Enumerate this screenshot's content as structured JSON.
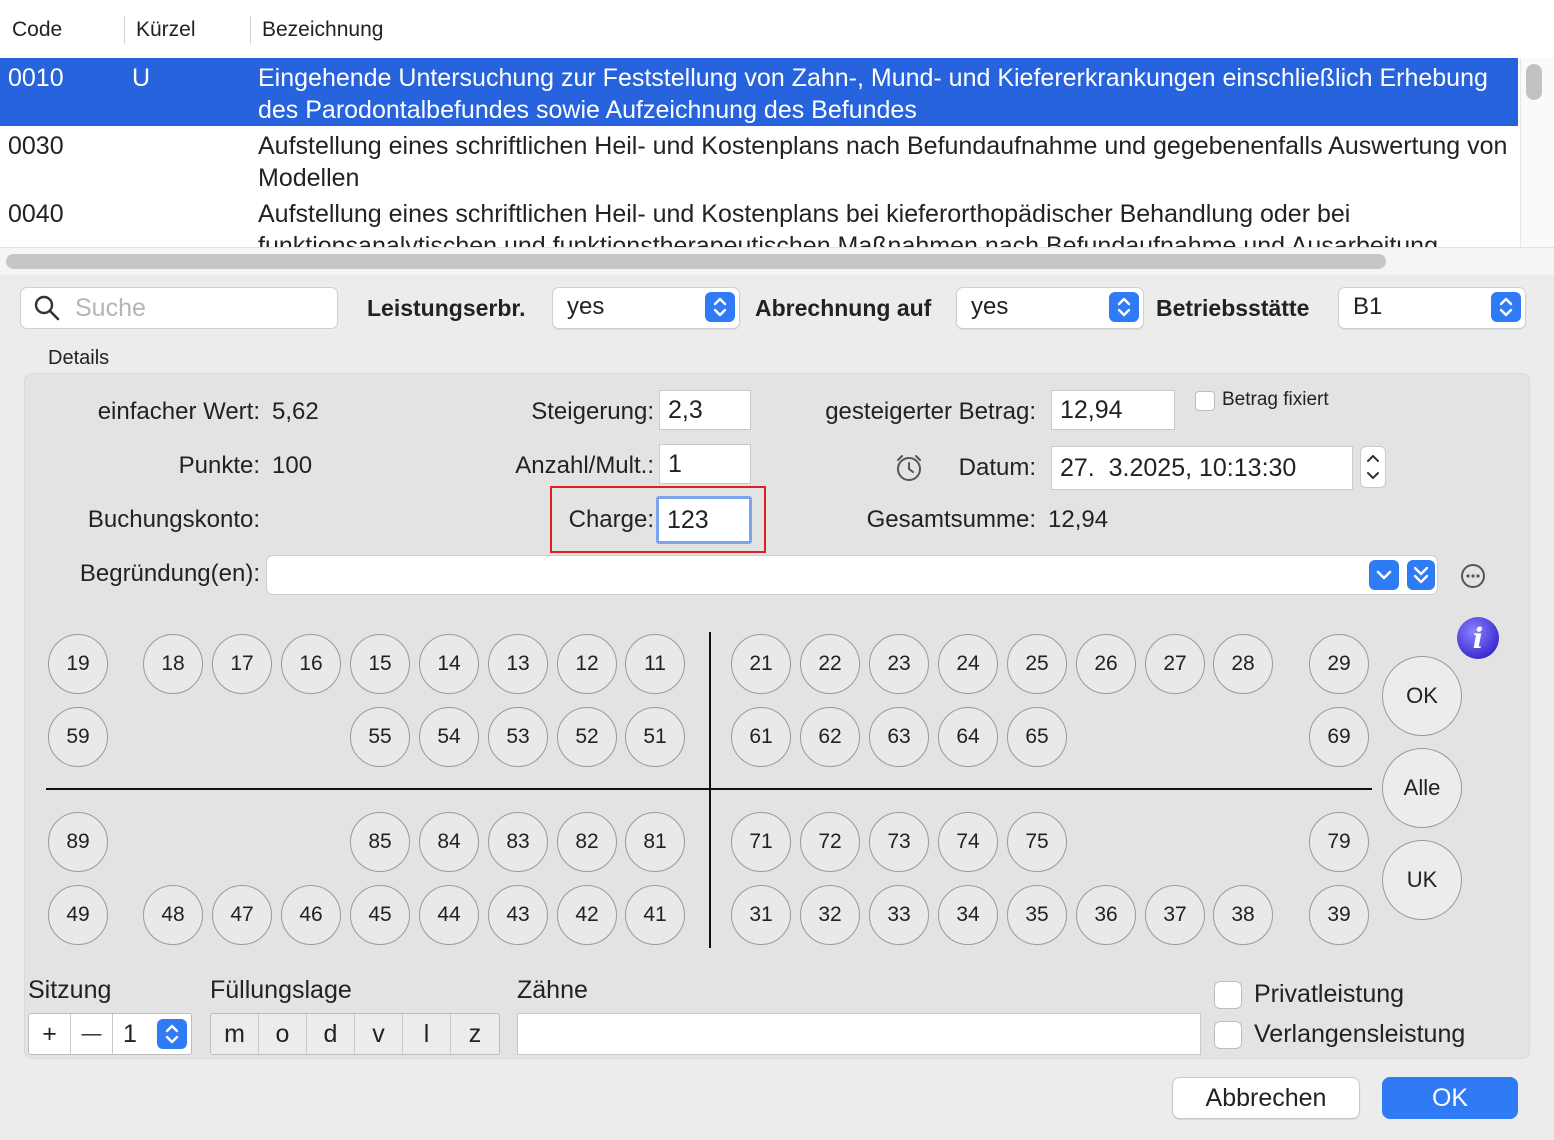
{
  "table": {
    "headers": {
      "code": "Code",
      "kuerzel": "Kürzel",
      "bezeichnung": "Bezeichnung"
    },
    "rows": [
      {
        "code": "0010",
        "kuerzel": "U",
        "bezeichnung": "Eingehende Untersuchung zur Feststellung von Zahn-, Mund- und Kiefererkrankungen einschließlich Erhebung des Parodontalbefundes sowie Aufzeichnung des Befundes",
        "selected": true
      },
      {
        "code": "0030",
        "kuerzel": "",
        "bezeichnung": "Aufstellung eines schriftlichen Heil- und Kostenplans nach Befundaufnahme und gegebenenfalls Auswertung von Modellen",
        "selected": false
      },
      {
        "code": "0040",
        "kuerzel": "",
        "bezeichnung": "Aufstellung eines schriftlichen Heil- und Kostenplans bei kieferorthopädischer Behandlung oder bei funktionsanalytischen und funktionstherapeutischen Maßnahmen nach Befundaufnahme und Ausarbeitung",
        "selected": false
      }
    ]
  },
  "toolbar": {
    "search_placeholder": "Suche",
    "leistungserbr_label": "Leistungserbr.",
    "leistungserbr_value": "yes",
    "abrechnung_label": "Abrechnung auf",
    "abrechnung_value": "yes",
    "betriebsstaette_label": "Betriebsstätte",
    "betriebsstaette_value": "B1"
  },
  "details": {
    "title": "Details",
    "einfacher_wert_label": "einfacher Wert:",
    "einfacher_wert_value": "5,62",
    "punkte_label": "Punkte:",
    "punkte_value": "100",
    "buchungskonto_label": "Buchungskonto:",
    "steigerung_label": "Steigerung:",
    "steigerung_value": "2,3",
    "anzahl_label": "Anzahl/Mult.:",
    "anzahl_value": "1",
    "charge_label": "Charge:",
    "charge_value": "123",
    "gesteigerter_betrag_label": "gesteigerter Betrag:",
    "gesteigerter_betrag_value": "12,94",
    "betrag_fixiert_label": "Betrag fixiert",
    "datum_label": "Datum:",
    "datum_value": "27.  3.2025, 10:13:30",
    "gesamtsumme_label": "Gesamtsumme:",
    "gesamtsumme_value": "12,94",
    "begruendung_label": "Begründung(en):",
    "begruendung_value": ""
  },
  "teeth": {
    "upper_right_perm": [
      "18",
      "17",
      "16",
      "15",
      "14",
      "13",
      "12",
      "11"
    ],
    "upper_left_perm": [
      "21",
      "22",
      "23",
      "24",
      "25",
      "26",
      "27",
      "28"
    ],
    "upper_right_dec": [
      "55",
      "54",
      "53",
      "52",
      "51"
    ],
    "upper_left_dec": [
      "61",
      "62",
      "63",
      "64",
      "65"
    ],
    "lower_right_dec": [
      "85",
      "84",
      "83",
      "82",
      "81"
    ],
    "lower_left_dec": [
      "71",
      "72",
      "73",
      "74",
      "75"
    ],
    "lower_right_perm": [
      "48",
      "47",
      "46",
      "45",
      "44",
      "43",
      "42",
      "41"
    ],
    "lower_left_perm": [
      "31",
      "32",
      "33",
      "34",
      "35",
      "36",
      "37",
      "38"
    ],
    "side_left": [
      "19",
      "59",
      "89",
      "49"
    ],
    "side_right": [
      "29",
      "69",
      "79",
      "39"
    ]
  },
  "jaw_buttons": {
    "ok": "OK",
    "alle": "Alle",
    "uk": "UK"
  },
  "bottom": {
    "sitzung_label": "Sitzung",
    "sitzung_plus": "+",
    "sitzung_minus": "—",
    "sitzung_value": "1",
    "fuellungslage_label": "Füllungslage",
    "fuellungslage_options": [
      "m",
      "o",
      "d",
      "v",
      "l",
      "z"
    ],
    "zaehne_label": "Zähne",
    "zaehne_value": "",
    "privatleistung_label": "Privatleistung",
    "verlangensleistung_label": "Verlangensleistung"
  },
  "footer": {
    "cancel_label": "Abbrechen",
    "ok_label": "OK"
  },
  "colors": {
    "accent": "#2663dc",
    "button_blue": "#2f7bf5",
    "highlight_red": "#e02020"
  }
}
